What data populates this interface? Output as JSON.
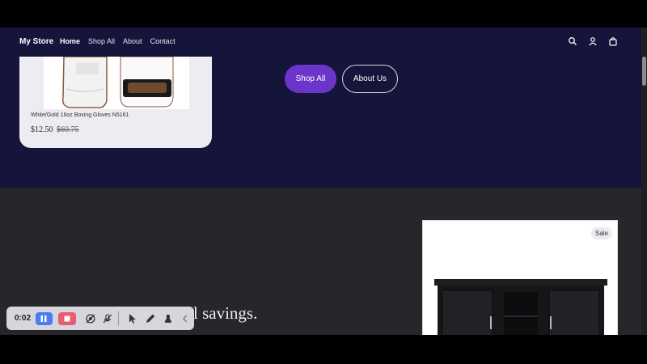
{
  "nav": {
    "brand": "My Store",
    "links": [
      "Home",
      "Shop All",
      "About",
      "Contact"
    ],
    "icons": [
      "search-icon",
      "account-icon",
      "cart-icon"
    ]
  },
  "hero": {
    "buttons": {
      "primary": "Shop All",
      "secondary": "About Us"
    },
    "product": {
      "title": "White/Gold 16oz Boxing Gloves N5161",
      "price": "$12.50",
      "compare_price": "$60.75"
    }
  },
  "section": {
    "headline_fragment": "l savings.",
    "product_badge": "Sale"
  },
  "recorder": {
    "time": "0:02",
    "tools": [
      "pause-icon",
      "stop-icon",
      "camera-off-icon",
      "mic-off-icon",
      "pointer-icon",
      "pen-icon",
      "highlighter-icon",
      "collapse-chevron-icon"
    ]
  },
  "colors": {
    "nav_bg": "#15143a",
    "accent": "#6b35c9",
    "section_bg": "#26262b",
    "pause_blue": "#4c7cf2",
    "stop_red": "#e95c72"
  }
}
